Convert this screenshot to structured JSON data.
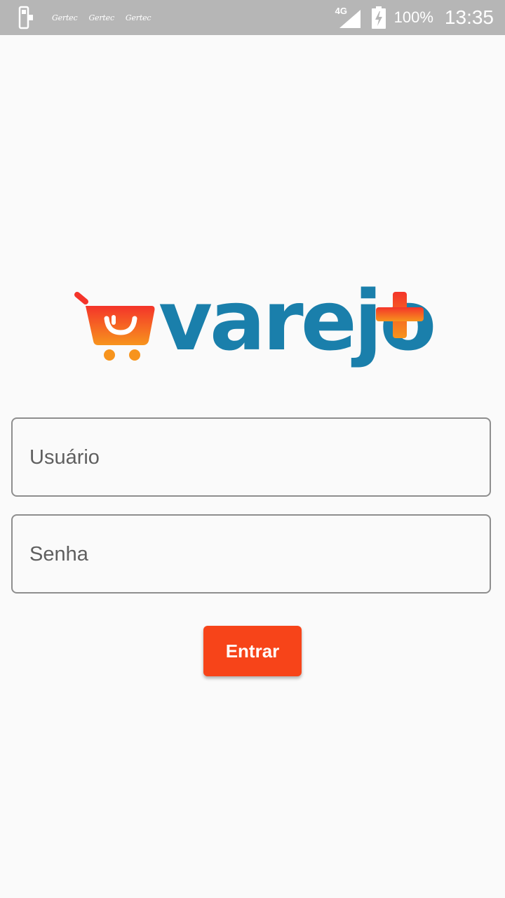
{
  "status_bar": {
    "brand_labels": [
      "Gertec",
      "Gertec",
      "Gertec"
    ],
    "network": "4G",
    "battery_percent": "100%",
    "time": "13:35"
  },
  "logo": {
    "wordmark": "varejo"
  },
  "form": {
    "username_placeholder": "Usuário",
    "password_placeholder": "Senha",
    "submit_label": "Entrar"
  },
  "colors": {
    "accent": "#f74419",
    "logo_blue": "#1a7fab",
    "status_bar": "#b6b6b6",
    "background": "#fafafa"
  },
  "icons": [
    "pos-terminal-icon",
    "cellular-signal-icon",
    "battery-charging-icon",
    "shopping-cart-logo-icon",
    "plus-logo-icon"
  ]
}
